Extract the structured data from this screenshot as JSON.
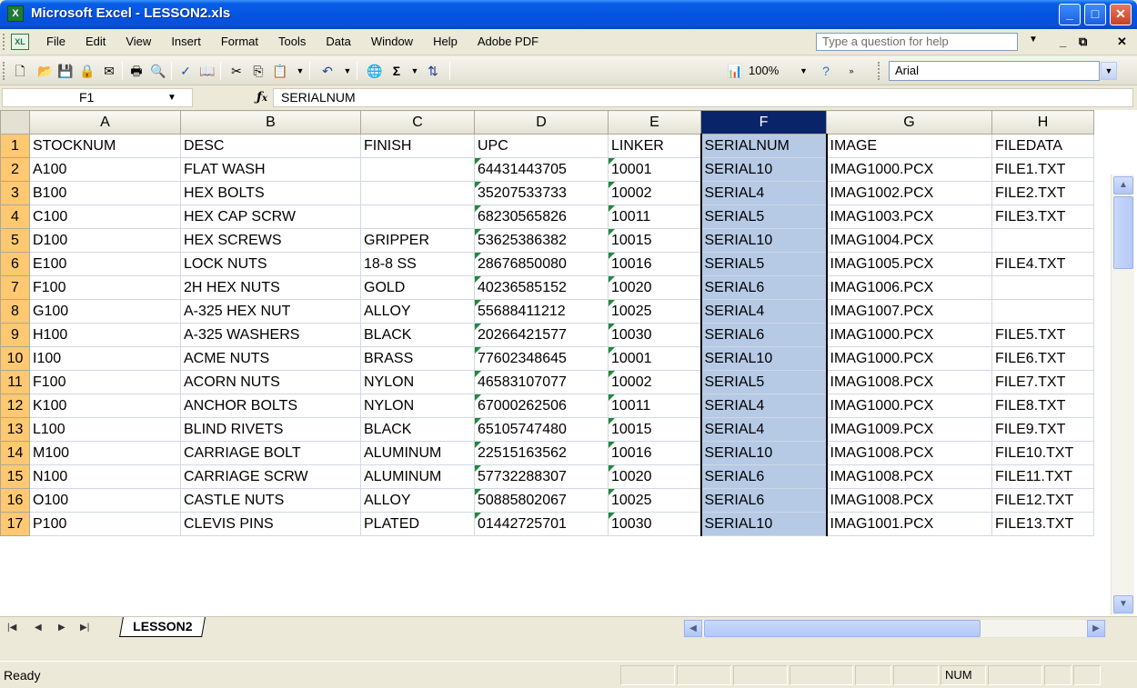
{
  "window": {
    "title": "Microsoft Excel - LESSON2.xls",
    "app_icon": "excel-icon",
    "controls": [
      "_",
      "□",
      "✕"
    ]
  },
  "menu": {
    "items": [
      "File",
      "Edit",
      "View",
      "Insert",
      "Format",
      "Tools",
      "Data",
      "Window",
      "Help",
      "Adobe PDF"
    ],
    "help_placeholder": "Type a question for help",
    "doc_controls": [
      "_",
      "⧉",
      "✕"
    ]
  },
  "toolbar": {
    "zoom": "100%",
    "font": "Arial",
    "icons": [
      "new-icon",
      "open-icon",
      "save-icon",
      "permission-icon",
      "email-icon",
      "print-icon",
      "print-preview-icon",
      "spelling-icon",
      "research-icon",
      "cut-icon",
      "copy-icon",
      "paste-icon",
      "undo-icon",
      "hyperlink-icon",
      "autosum-icon",
      "sort-ascending-icon",
      "chart-wizard-icon",
      "help-icon"
    ]
  },
  "formula_bar": {
    "name_box": "F1",
    "fx": "fx",
    "value": "SERIALNUM"
  },
  "sheet": {
    "columns": [
      "A",
      "B",
      "C",
      "D",
      "E",
      "F",
      "G",
      "H"
    ],
    "selected_column": "F",
    "rows": [
      {
        "n": "1",
        "cells": [
          "STOCKNUM",
          "DESC",
          "FINISH",
          "UPC",
          "LINKER",
          "SERIALNUM",
          "IMAGE",
          "FILEDATA"
        ]
      },
      {
        "n": "2",
        "cells": [
          "A100",
          "FLAT WASH",
          "",
          "64431443705",
          "10001",
          "SERIAL10",
          "IMAG1000.PCX",
          "FILE1.TXT"
        ]
      },
      {
        "n": "3",
        "cells": [
          "B100",
          "HEX BOLTS",
          "",
          "35207533733",
          "10002",
          "SERIAL4",
          "IMAG1002.PCX",
          "FILE2.TXT"
        ]
      },
      {
        "n": "4",
        "cells": [
          "C100",
          "HEX CAP SCRW",
          "",
          "68230565826",
          "10011",
          "SERIAL5",
          "IMAG1003.PCX",
          "FILE3.TXT"
        ]
      },
      {
        "n": "5",
        "cells": [
          "D100",
          "HEX SCREWS",
          "GRIPPER",
          "53625386382",
          "10015",
          "SERIAL10",
          "IMAG1004.PCX",
          ""
        ]
      },
      {
        "n": "6",
        "cells": [
          "E100",
          "LOCK NUTS",
          "18-8 SS",
          "28676850080",
          "10016",
          "SERIAL5",
          "IMAG1005.PCX",
          "FILE4.TXT"
        ]
      },
      {
        "n": "7",
        "cells": [
          "F100",
          "2H HEX NUTS",
          "GOLD",
          "40236585152",
          "10020",
          "SERIAL6",
          "IMAG1006.PCX",
          ""
        ]
      },
      {
        "n": "8",
        "cells": [
          "G100",
          "A-325 HEX NUT",
          "ALLOY",
          "55688411212",
          "10025",
          "SERIAL4",
          "IMAG1007.PCX",
          ""
        ]
      },
      {
        "n": "9",
        "cells": [
          "H100",
          "A-325 WASHERS",
          "BLACK",
          "20266421577",
          "10030",
          "SERIAL6",
          "IMAG1000.PCX",
          "FILE5.TXT"
        ]
      },
      {
        "n": "10",
        "cells": [
          "I100",
          "ACME NUTS",
          "BRASS",
          "77602348645",
          "10001",
          "SERIAL10",
          "IMAG1000.PCX",
          "FILE6.TXT"
        ]
      },
      {
        "n": "11",
        "cells": [
          "F100",
          "ACORN NUTS",
          "NYLON",
          "46583107077",
          "10002",
          "SERIAL5",
          "IMAG1008.PCX",
          "FILE7.TXT"
        ]
      },
      {
        "n": "12",
        "cells": [
          "K100",
          "ANCHOR BOLTS",
          "NYLON",
          "67000262506",
          "10011",
          "SERIAL4",
          "IMAG1000.PCX",
          "FILE8.TXT"
        ]
      },
      {
        "n": "13",
        "cells": [
          "L100",
          "BLIND RIVETS",
          "BLACK",
          "65105747480",
          "10015",
          "SERIAL4",
          "IMAG1009.PCX",
          "FILE9.TXT"
        ]
      },
      {
        "n": "14",
        "cells": [
          "M100",
          "CARRIAGE BOLT",
          "ALUMINUM",
          "22515163562",
          "10016",
          "SERIAL10",
          "IMAG1008.PCX",
          "FILE10.TXT"
        ]
      },
      {
        "n": "15",
        "cells": [
          "N100",
          "CARRIAGE SCRW",
          "ALUMINUM",
          "57732288307",
          "10020",
          "SERIAL6",
          "IMAG1008.PCX",
          "FILE11.TXT"
        ]
      },
      {
        "n": "16",
        "cells": [
          "O100",
          "CASTLE NUTS",
          "ALLOY",
          "50885802067",
          "10025",
          "SERIAL6",
          "IMAG1008.PCX",
          "FILE12.TXT"
        ]
      },
      {
        "n": "17",
        "cells": [
          "P100",
          "CLEVIS PINS",
          "PLATED",
          "01442725701",
          "10030",
          "SERIAL10",
          "IMAG1001.PCX",
          "FILE13.TXT"
        ]
      }
    ]
  },
  "sheet_tabs": [
    "LESSON2"
  ],
  "status": {
    "text": "Ready",
    "num": "NUM"
  },
  "colors": {
    "titlebar": "#0A5FE4",
    "selection": "#B6CAE6",
    "row_header_selected": "#FFC871",
    "column_header_selected": "#0A246A"
  }
}
